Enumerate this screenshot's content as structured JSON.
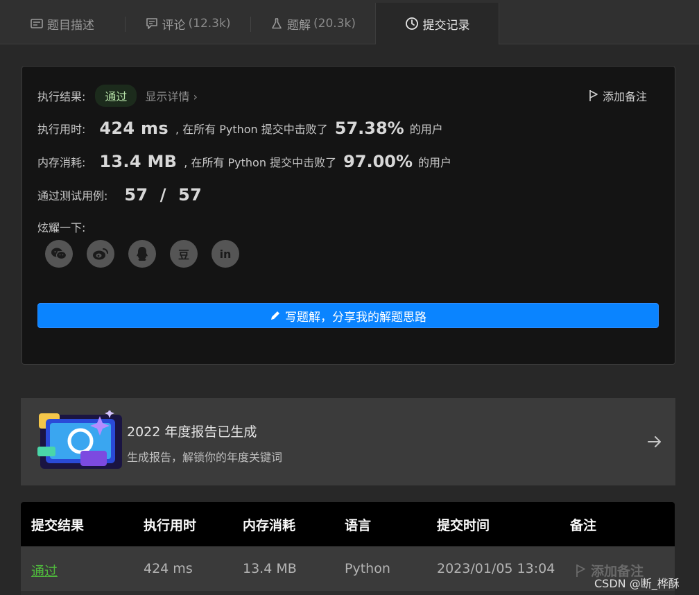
{
  "tabs": [
    {
      "label": "题目描述",
      "count": ""
    },
    {
      "label": "评论",
      "count": "(12.3k)"
    },
    {
      "label": "题解",
      "count": "(20.3k)"
    },
    {
      "label": "提交记录",
      "count": ""
    }
  ],
  "result": {
    "result_label": "执行结果:",
    "status": "通过",
    "detail_link": "显示详情 ›",
    "add_note": "添加备注",
    "time_label": "执行用时:",
    "time_value": "424 ms",
    "time_text_a": ", 在所有 Python 提交中击败了",
    "time_pct": "57.38%",
    "time_text_b": "的用户",
    "mem_label": "内存消耗:",
    "mem_value": "13.4 MB",
    "mem_text_a": ", 在所有 Python 提交中击败了",
    "mem_pct": "97.00%",
    "mem_text_b": "的用户",
    "cases_label": "通过测试用例:",
    "cases_value": "57  /  57",
    "share_label": "炫耀一下:",
    "share_icons": [
      "wechat-icon",
      "weibo-icon",
      "qq-icon",
      "douban-icon",
      "linkedin-icon"
    ],
    "douban_glyph": "豆",
    "linkedin_glyph": "in",
    "write_button": "写题解，分享我的解题思路"
  },
  "report": {
    "title": "2022 年度报告已生成",
    "subtitle": "生成报告，解锁你的年度关键词"
  },
  "table": {
    "headers": [
      "提交结果",
      "执行用时",
      "内存消耗",
      "语言",
      "提交时间",
      "备注"
    ],
    "rows": [
      {
        "result": "通过",
        "time": "424 ms",
        "memory": "13.4 MB",
        "language": "Python",
        "submitted": "2023/01/05 13:04",
        "note": "添加备注"
      }
    ]
  },
  "watermark": "CSDN @断_桦酥",
  "colors": {
    "accent": "#0a84ff",
    "pass": "#4fb83c",
    "background": "#282828"
  }
}
